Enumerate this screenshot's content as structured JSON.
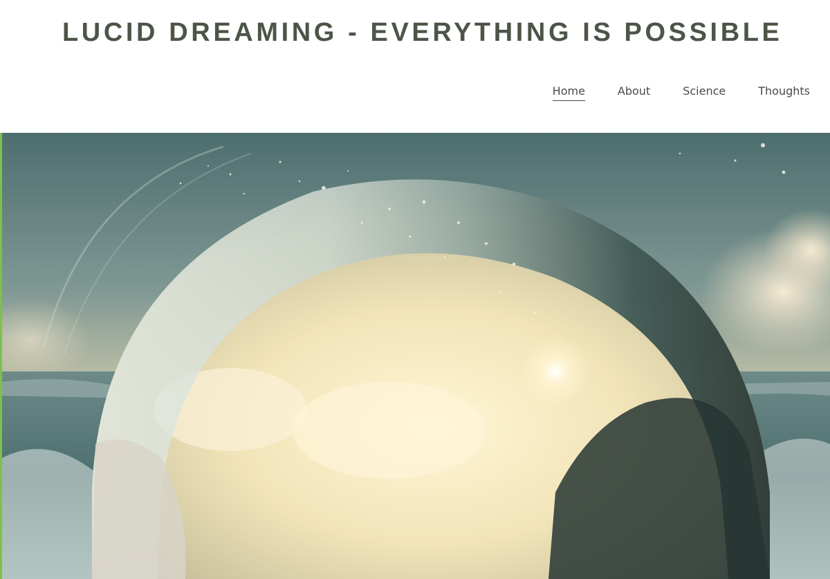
{
  "site": {
    "title": "LUCID DREAMING - EVERYTHING IS POSSIBLE"
  },
  "nav": {
    "items": [
      {
        "label": "Home",
        "active": true
      },
      {
        "label": "About",
        "active": false
      },
      {
        "label": "Science",
        "active": false
      },
      {
        "label": "Thoughts",
        "active": false
      }
    ]
  },
  "colors": {
    "accent": "#7cc24a",
    "title_text": "#4c5547",
    "nav_text": "#4a4a4a"
  }
}
